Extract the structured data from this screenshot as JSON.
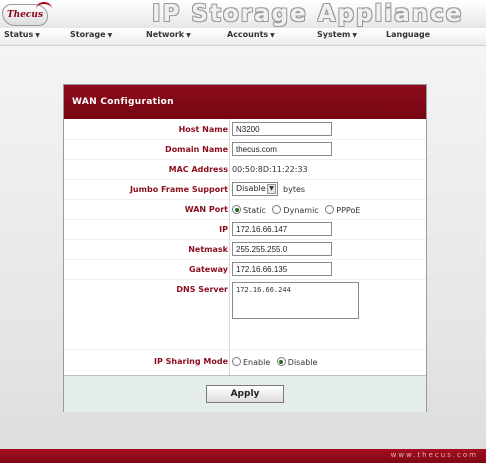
{
  "header": {
    "logo_text": "Thecus",
    "app_title": "IP Storage Appliance"
  },
  "menu": [
    {
      "label": "Status",
      "caret": "▼"
    },
    {
      "label": "Storage",
      "caret": "▼"
    },
    {
      "label": "Network",
      "caret": "▼"
    },
    {
      "label": "Accounts",
      "caret": "▼"
    },
    {
      "label": "System",
      "caret": "▼"
    },
    {
      "label": "Language",
      "caret": ""
    }
  ],
  "panel": {
    "title": "WAN Configuration",
    "host_name": {
      "label": "Host Name",
      "value": "N3200"
    },
    "domain_name": {
      "label": "Domain Name",
      "value": "thecus.com"
    },
    "mac_address": {
      "label": "MAC Address",
      "value": "00:50:8D:11:22:33"
    },
    "jumbo_frame": {
      "label": "Jumbo Frame Support",
      "selected": "Disable",
      "unit": "bytes"
    },
    "wan_port": {
      "label": "WAN Port",
      "options": [
        "Static",
        "Dynamic",
        "PPPoE"
      ],
      "selected": "Static"
    },
    "ip": {
      "label": "IP",
      "value": "172.16.66.147"
    },
    "netmask": {
      "label": "Netmask",
      "value": "255.255.255.0"
    },
    "gateway": {
      "label": "Gateway",
      "value": "172.16.66.135"
    },
    "dns_server": {
      "label": "DNS Server",
      "value": "172.16.66.244"
    },
    "ip_sharing": {
      "label": "IP Sharing Mode",
      "options": [
        "Enable",
        "Disable"
      ],
      "selected": "Disable"
    },
    "apply_label": "Apply"
  },
  "footer": {
    "url": "www.thecus.com"
  },
  "colors": {
    "brand_red": "#8e0b1c",
    "label_red": "#8a0e1c",
    "radio_dot": "#1d6d1d"
  }
}
